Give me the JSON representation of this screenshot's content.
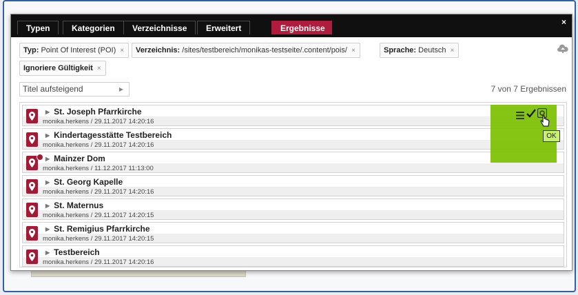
{
  "tabs": [
    {
      "label": "Typen"
    },
    {
      "label": "Kategorien"
    },
    {
      "label": "Verzeichnisse"
    },
    {
      "label": "Erweitert"
    },
    {
      "label": "Ergebnisse",
      "active": true
    }
  ],
  "close_label": "×",
  "filters": [
    {
      "key": "Typ:",
      "value": " Point Of Interest (POI)",
      "remove": "×"
    },
    {
      "key": "Verzeichnis:",
      "value": " /sites/testbereich/monikas-testseite/.content/pois/",
      "remove": "×"
    },
    {
      "key": "Sprache:",
      "value": " Deutsch",
      "remove": "×"
    },
    {
      "key": "Ignoriere Gültigkeit",
      "value": "",
      "remove": "×"
    }
  ],
  "sort": {
    "value": "Titel aufsteigend"
  },
  "result_count": "7 von 7 Ergebnissen",
  "results": [
    {
      "title": "St. Joseph Pfarrkirche",
      "meta": "monika.herkens / 29.11.2017 14:20:16"
    },
    {
      "title": "Kindertagesstätte Testbereich",
      "meta": "monika.herkens / 29.11.2017 14:20:16"
    },
    {
      "title": "Mainzer Dom",
      "meta": "monika.herkens / 11.12.2017 11:13:00"
    },
    {
      "title": "St. Georg Kapelle",
      "meta": "monika.herkens / 29.11.2017 14:20:16"
    },
    {
      "title": "St. Maternus",
      "meta": "monika.herkens / 29.11.2017 14:20:15"
    },
    {
      "title": "St. Remigius Pfarrkirche",
      "meta": "monika.herkens / 29.11.2017 14:20:15"
    },
    {
      "title": "Testbereich",
      "meta": "monika.herkens / 29.11.2017 14:20:16"
    }
  ],
  "ok_label": "OK",
  "colors": {
    "accent": "#b01c3b",
    "highlight": "#7cc000",
    "titlebar": "#101010"
  },
  "icons": [
    "map-pin-icon",
    "menu-icon",
    "check-icon",
    "preview-icon",
    "cloud-upload-icon",
    "hand-cursor-icon"
  ]
}
